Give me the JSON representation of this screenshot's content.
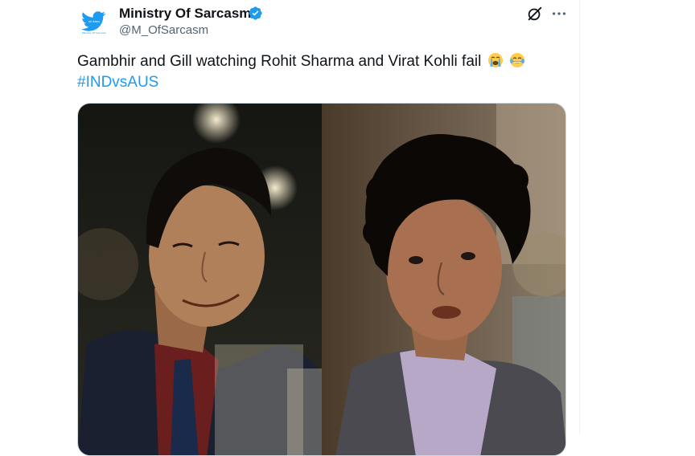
{
  "author": {
    "display_name": "Ministry Of Sarcasm",
    "handle": "@M_OfSarcasm",
    "verified": true,
    "avatar_text": "Ministry Of Sarcasm",
    "avatar_icon": "bird-icon"
  },
  "tweet": {
    "text": "Gambhir and Gill watching Rohit Sharma and Virat Kohli fail",
    "emojis": [
      "loudly-crying-face",
      "face-with-tears-of-joy"
    ],
    "hashtag": "#INDvsAUS"
  },
  "actions": {
    "grok_icon": "grok-icon",
    "more_icon": "more-icon"
  },
  "media": {
    "panels": [
      "left-panel-smirking-man",
      "right-panel-smirking-man"
    ]
  },
  "colors": {
    "accent": "#1d9bf0",
    "secondary_text": "#536471",
    "primary_text": "#0f1419",
    "divider": "#eff3f4"
  }
}
